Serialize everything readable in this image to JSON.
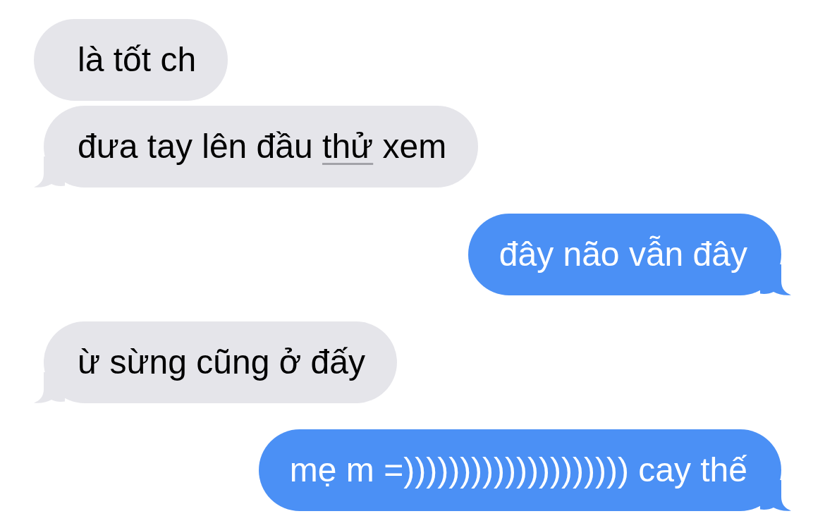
{
  "messages": [
    {
      "kind": "received",
      "tail": false,
      "parts": [
        {
          "text": "là tốt ch",
          "underlined": false
        }
      ]
    },
    {
      "kind": "received",
      "tail": true,
      "parts": [
        {
          "text": "đưa tay lên đầu ",
          "underlined": false
        },
        {
          "text": "thử",
          "underlined": true
        },
        {
          "text": " xem",
          "underlined": false
        }
      ]
    },
    {
      "kind": "sent",
      "tail": true,
      "parts": [
        {
          "text": "đây não vẫn đây",
          "underlined": false
        }
      ]
    },
    {
      "kind": "received",
      "tail": true,
      "parts": [
        {
          "text": "ừ sừng cũng ở đấy",
          "underlined": false
        }
      ]
    },
    {
      "kind": "sent",
      "tail": true,
      "parts": [
        {
          "text": "mẹ m =)))))))))))))))))))) cay thế",
          "underlined": false
        }
      ]
    }
  ]
}
